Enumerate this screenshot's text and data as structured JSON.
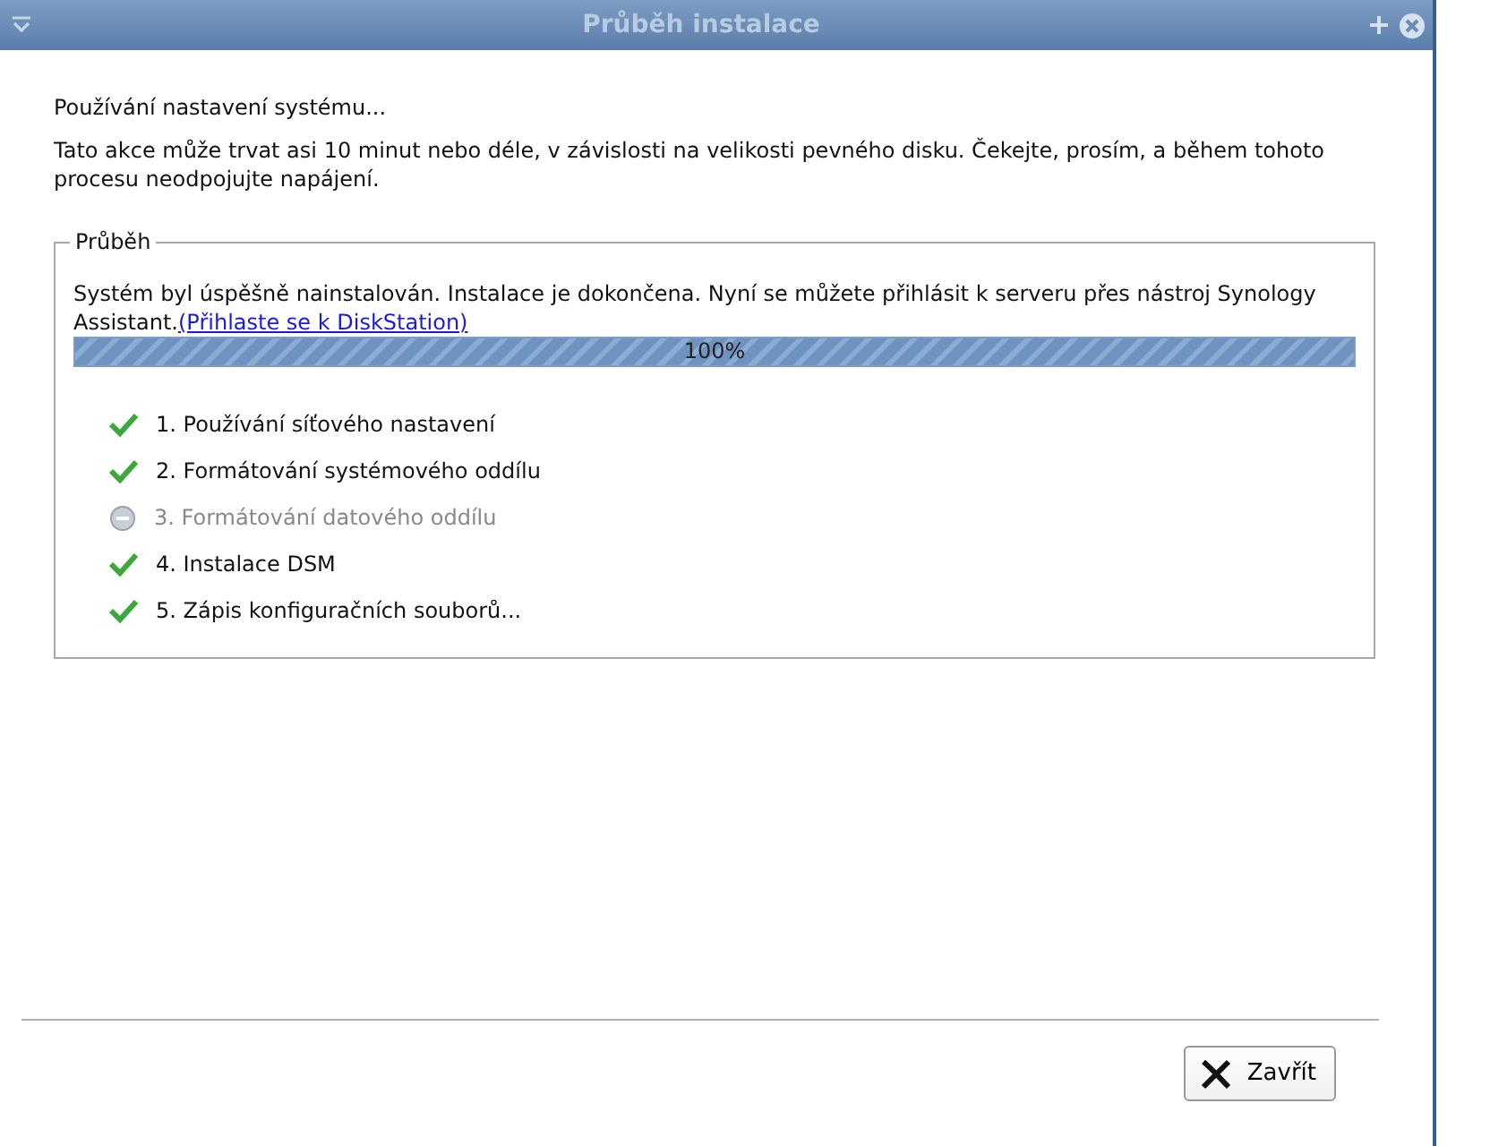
{
  "window": {
    "title": "Průběh instalace"
  },
  "status_heading": "Používání nastavení systému...",
  "description": "Tato akce může trvat asi 10 minut nebo déle, v závislosti na velikosti pevného disku. Čekejte, prosím, a během tohoto procesu neodpojujte napájení.",
  "progress_group": {
    "legend": "Průběh",
    "message": "Systém byl úspěšně nainstalován. Instalace je dokončena. Nyní se můžete přihlásit k serveru přes nástroj Synology Assistant.",
    "link": "(Přihlaste se k DiskStation)",
    "level": 1,
    "reading": "100%",
    "steps": [
      {
        "label": "1. Používání síťového nastavení",
        "done": true
      },
      {
        "label": "2. Formátování systémového oddílu",
        "done": true
      },
      {
        "label": "3. Formátování datového oddílu",
        "done": false
      },
      {
        "label": "4. Instalace DSM",
        "done": true
      },
      {
        "label": "5. Zápis konfiguračních souborů...",
        "done": true
      }
    ]
  },
  "buttons": [
    {
      "label": "Zavřít",
      "kind": "close"
    }
  ]
}
